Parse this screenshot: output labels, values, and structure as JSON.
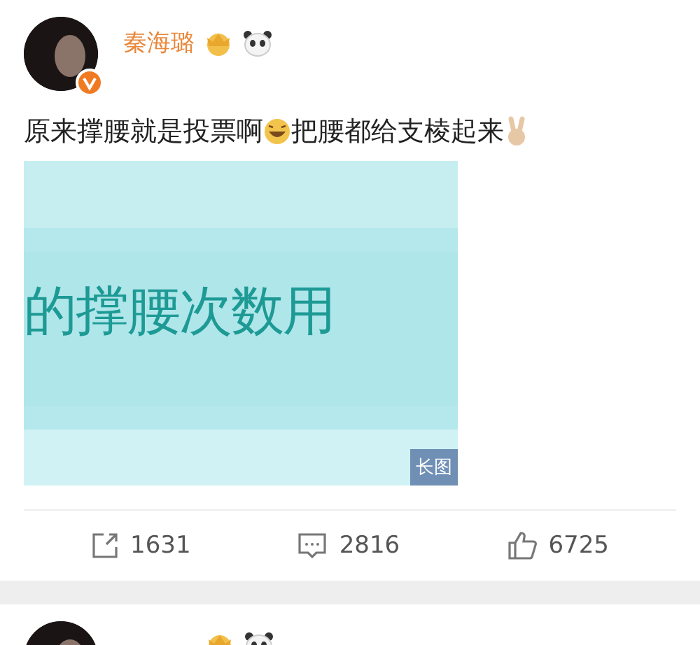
{
  "posts": [
    {
      "author": "秦海璐",
      "verified": true,
      "text_parts": [
        "原来撑腰就是投票啊",
        "把腰都给支棱起来"
      ],
      "image": {
        "caption": "的撑腰次数用",
        "badge": "长图"
      },
      "actions": [
        {
          "kind": "repost",
          "count": "1631"
        },
        {
          "kind": "comment",
          "count": "2816"
        },
        {
          "kind": "like",
          "count": "6725"
        }
      ]
    }
  ],
  "next_post_peek": true
}
